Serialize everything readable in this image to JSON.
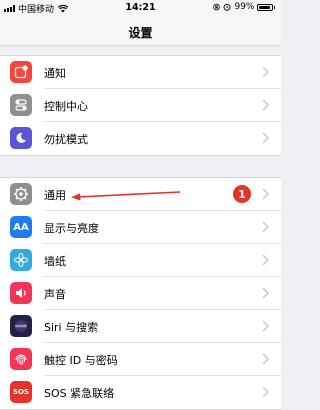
{
  "status_bar": {
    "carrier": "中国移动",
    "time": "14:21",
    "battery_percent": "99%",
    "battery_level": 0.99,
    "icons": [
      "signal-icon",
      "wifi-icon",
      "lock-rotation-icon",
      "alarm-icon",
      "battery-icon"
    ]
  },
  "nav": {
    "title": "设置"
  },
  "groups": [
    {
      "items": [
        {
          "label": "通知",
          "icon": "notifications-icon",
          "color": "#f2473b"
        },
        {
          "label": "控制中心",
          "icon": "control-center-icon",
          "color": "#8e8e93"
        },
        {
          "label": "勿扰模式",
          "icon": "moon-icon",
          "color": "#5856d6"
        }
      ]
    },
    {
      "items": [
        {
          "label": "通用",
          "icon": "gear-icon",
          "color": "#8e8e93",
          "badge": "1"
        },
        {
          "label": "显示与亮度",
          "icon": "text-size-icon",
          "color": "#1e7cf0"
        },
        {
          "label": "墙纸",
          "icon": "flower-icon",
          "color": "#33aadc"
        },
        {
          "label": "声音",
          "icon": "speaker-icon",
          "color": "#f2365a"
        },
        {
          "label": "Siri 与搜索",
          "icon": "siri-icon",
          "color": "#222244"
        },
        {
          "label": "触控 ID 与密码",
          "icon": "fingerprint-icon",
          "color": "#f2365a"
        },
        {
          "label": "SOS 紧急联络",
          "icon": "sos-icon",
          "color": "#e5332a",
          "icon_text": "SOS"
        }
      ]
    }
  ],
  "icon_text": {
    "text_size": "AA"
  },
  "colors": {
    "arrow": "#e5332a",
    "badge": "#e5332a",
    "chevron": "#c7c7cc"
  }
}
